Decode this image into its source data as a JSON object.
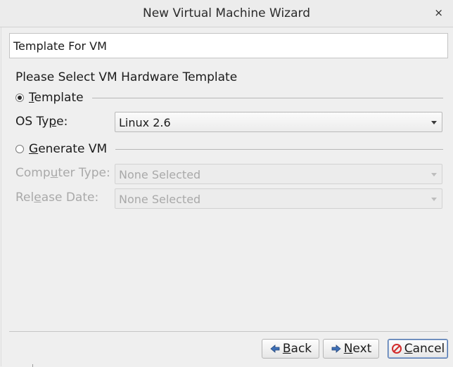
{
  "window": {
    "title": "New Virtual Machine Wizard",
    "close_glyph": "×"
  },
  "header": {
    "text": "Template For VM"
  },
  "form": {
    "section_title": "Please Select VM Hardware Template",
    "template_radio": {
      "label_mnemonic": "T",
      "label_rest": "emplate",
      "checked": true
    },
    "os_type": {
      "label_pre": "OS Ty",
      "label_mnemonic": "p",
      "label_post": "e:",
      "value": "Linux 2.6"
    },
    "generate_radio": {
      "label_mnemonic": "G",
      "label_rest": "enerate VM",
      "checked": false
    },
    "computer_type": {
      "label_pre": "Comp",
      "label_mnemonic": "u",
      "label_post": "ter Type:",
      "value": "None Selected",
      "enabled": false
    },
    "release_date": {
      "label_pre": "Rel",
      "label_mnemonic": "e",
      "label_post": "ase Date:",
      "value": "None Selected",
      "enabled": false
    }
  },
  "buttons": {
    "back": {
      "mnemonic": "B",
      "rest": "ack",
      "icon": "arrow-left-icon"
    },
    "next": {
      "mnemonic": "N",
      "rest": "ext",
      "icon": "arrow-right-icon"
    },
    "cancel": {
      "mnemonic": "C",
      "rest": "ancel",
      "icon": "cancel-icon",
      "focused": true
    }
  },
  "colors": {
    "icon_blue": "#3d6fb6",
    "cancel_red": "#d22b2b",
    "focus_border": "#4a6fa8"
  }
}
